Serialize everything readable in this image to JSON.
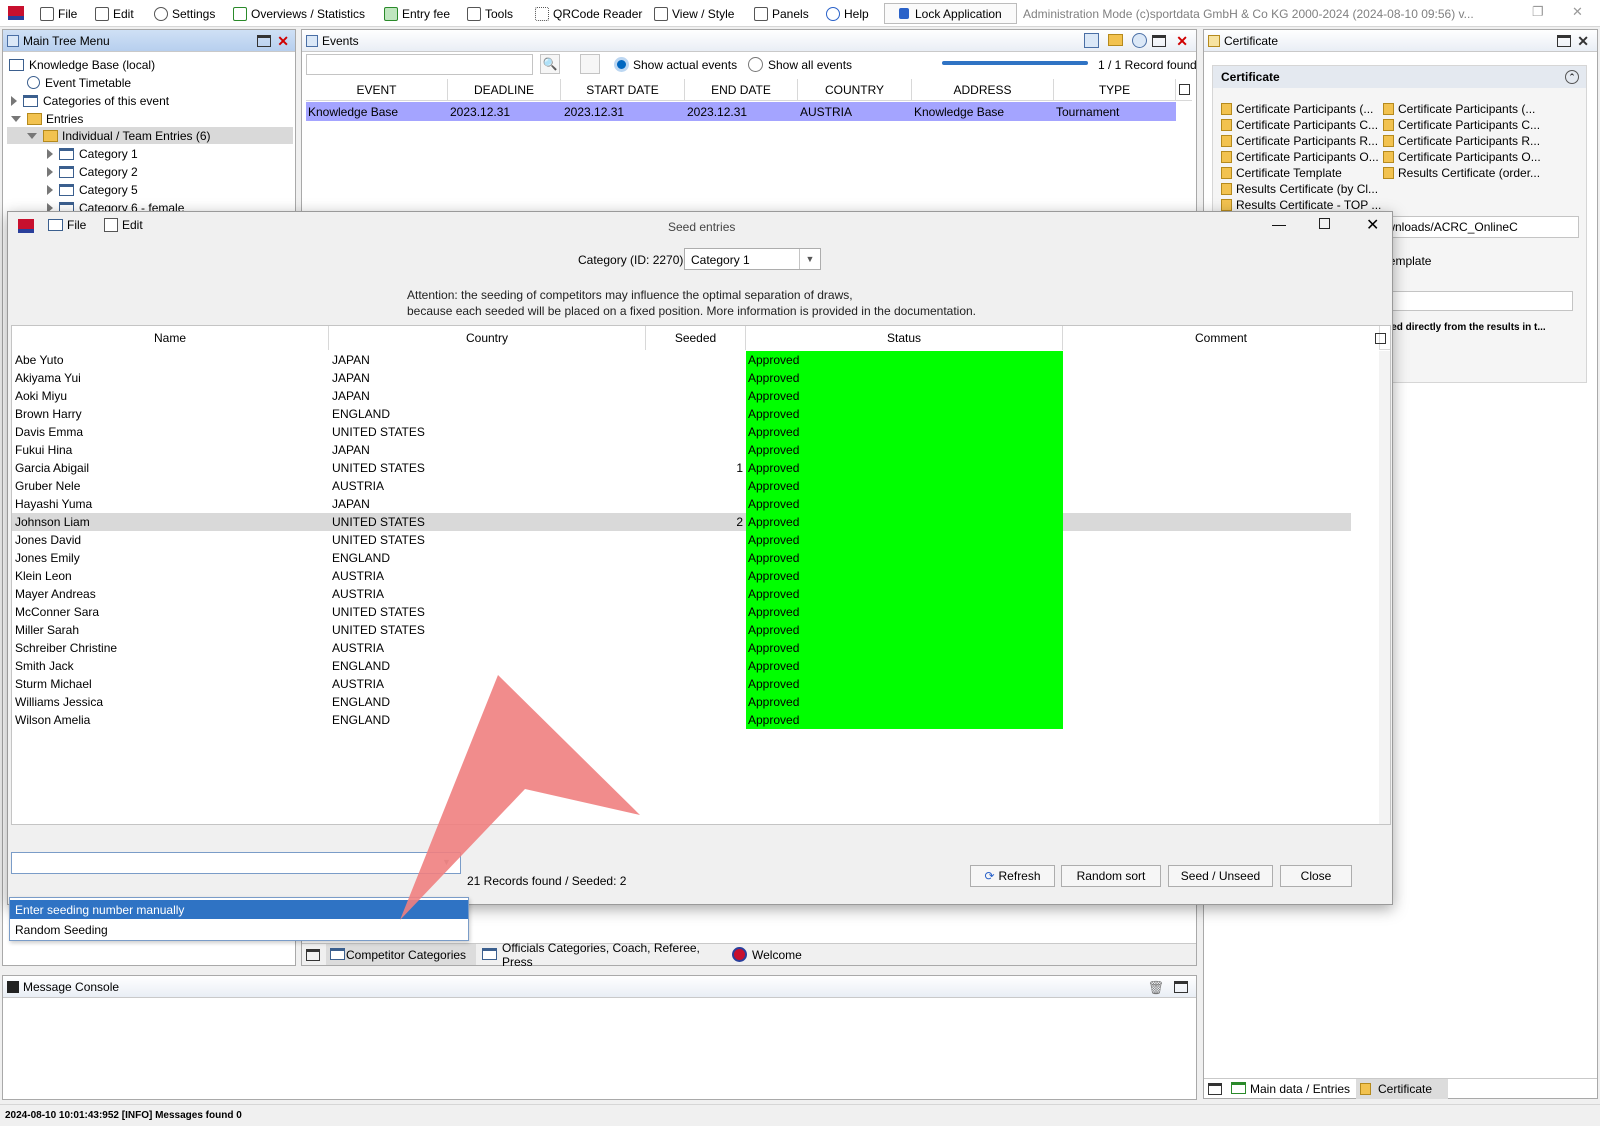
{
  "menubar": {
    "items": [
      "File",
      "Edit",
      "Settings",
      "Overviews / Statistics",
      "Entry fee",
      "Tools",
      "QRCode Reader",
      "View / Style",
      "Panels",
      "Help"
    ],
    "lock_label": "Lock Application",
    "status_text": "Administration Mode (c)sportdata GmbH & Co KG 2000-2024 (2024-08-10 09:56)  v..."
  },
  "tree": {
    "title": "Main Tree Menu",
    "items": [
      "Knowledge Base (local)",
      "Event Timetable",
      "Categories of this event",
      "Entries",
      "Individual / Team Entries (6)",
      "Category 1",
      "Category 2",
      "Category 5",
      "Category 6 - female"
    ]
  },
  "events": {
    "title": "Events",
    "show_actual": "Show actual events",
    "show_all": "Show all events",
    "progress": "100%",
    "record_count": "1 / 1 Record found",
    "columns": [
      "EVENT",
      "DEADLINE",
      "START DATE",
      "END DATE",
      "COUNTRY",
      "ADDRESS",
      "TYPE"
    ],
    "row": [
      "Knowledge Base",
      "2023.12.31",
      "2023.12.31",
      "2023.12.31",
      "AUSTRIA",
      "Knowledge Base",
      "Tournament"
    ],
    "tabs": [
      "Competitor Categories",
      "Officials Categories, Coach, Referee, Press",
      "Welcome"
    ]
  },
  "certificate": {
    "panel_title": "Certificate",
    "section_title": "Certificate",
    "left_items": [
      "Certificate Participants (...",
      "Certificate Participants C...",
      "Certificate Participants R...",
      "Certificate Participants O...",
      "Certificate Template",
      "Results Certificate (by Cl...",
      "Results Certificate - TOP ..."
    ],
    "right_items": [
      "Certificate Participants (...",
      "Certificate Participants C...",
      "Certificate Participants R...",
      "Certificate Participants O...",
      "Results Certificate (order..."
    ],
    "path_value": "me/Downloads/ACRC_OnlineC",
    "template_label": "er Template",
    "note": "printed directly from the results in t...",
    "tabs": [
      "Main data / Entries",
      "Certificate"
    ]
  },
  "console": {
    "title": "Message Console",
    "status_line": "2024-08-10 10:01:43:952 [INFO] Messages found 0"
  },
  "dialog": {
    "title": "Seed entries",
    "menu": [
      "File",
      "Edit"
    ],
    "category_label": "Category (ID: 2270)",
    "category_value": "Category 1",
    "attention_line1": "Attention: the seeding of competitors may influence the optimal separation of draws,",
    "attention_line2": "because each seeded will be placed on a fixed position. More information is provided in the documentation.",
    "columns": [
      "Name",
      "Country",
      "Seeded",
      "Status",
      "Comment"
    ],
    "rows": [
      {
        "name": "Abe Yuto",
        "country": "JAPAN",
        "seeded": "",
        "status": "Approved"
      },
      {
        "name": "Akiyama Yui",
        "country": "JAPAN",
        "seeded": "",
        "status": "Approved"
      },
      {
        "name": "Aoki Miyu",
        "country": "JAPAN",
        "seeded": "",
        "status": "Approved"
      },
      {
        "name": "Brown Harry",
        "country": "ENGLAND",
        "seeded": "",
        "status": "Approved"
      },
      {
        "name": "Davis Emma",
        "country": "UNITED STATES",
        "seeded": "",
        "status": "Approved"
      },
      {
        "name": "Fukui Hina",
        "country": "JAPAN",
        "seeded": "",
        "status": "Approved"
      },
      {
        "name": "Garcia Abigail",
        "country": "UNITED STATES",
        "seeded": "1",
        "status": "Approved"
      },
      {
        "name": "Gruber Nele",
        "country": "AUSTRIA",
        "seeded": "",
        "status": "Approved"
      },
      {
        "name": "Hayashi Yuma",
        "country": "JAPAN",
        "seeded": "",
        "status": "Approved"
      },
      {
        "name": "Johnson Liam",
        "country": "UNITED STATES",
        "seeded": "2",
        "status": "Approved"
      },
      {
        "name": "Jones David",
        "country": "UNITED STATES",
        "seeded": "",
        "status": "Approved"
      },
      {
        "name": "Jones Emily",
        "country": "ENGLAND",
        "seeded": "",
        "status": "Approved"
      },
      {
        "name": "Klein Leon",
        "country": "AUSTRIA",
        "seeded": "",
        "status": "Approved"
      },
      {
        "name": "Mayer Andreas",
        "country": "AUSTRIA",
        "seeded": "",
        "status": "Approved"
      },
      {
        "name": "McConner Sara",
        "country": "UNITED STATES",
        "seeded": "",
        "status": "Approved"
      },
      {
        "name": "Miller Sarah",
        "country": "UNITED STATES",
        "seeded": "",
        "status": "Approved"
      },
      {
        "name": "Schreiber Christine",
        "country": "AUSTRIA",
        "seeded": "",
        "status": "Approved"
      },
      {
        "name": "Smith Jack",
        "country": "ENGLAND",
        "seeded": "",
        "status": "Approved"
      },
      {
        "name": "Sturm Michael",
        "country": "AUSTRIA",
        "seeded": "",
        "status": "Approved"
      },
      {
        "name": "Williams Jessica",
        "country": "ENGLAND",
        "seeded": "",
        "status": "Approved"
      },
      {
        "name": "Wilson Amelia",
        "country": "ENGLAND",
        "seeded": "",
        "status": "Approved"
      }
    ],
    "selected_row": "Johnson Liam",
    "records_text": "21 Records found / Seeded: 2",
    "buttons": {
      "refresh": "Refresh",
      "random_sort": "Random sort",
      "seed_unseed": "Seed / Unseed",
      "close": "Close"
    },
    "dropdown_options": [
      "Enter seeding number manually",
      "Random Seeding"
    ]
  },
  "colors": {
    "approved": "#00ff00",
    "selected_event_row": "#a4a4ff",
    "dropdown_highlight": "#2f73c4",
    "annotation_arrow": "#f08080"
  }
}
